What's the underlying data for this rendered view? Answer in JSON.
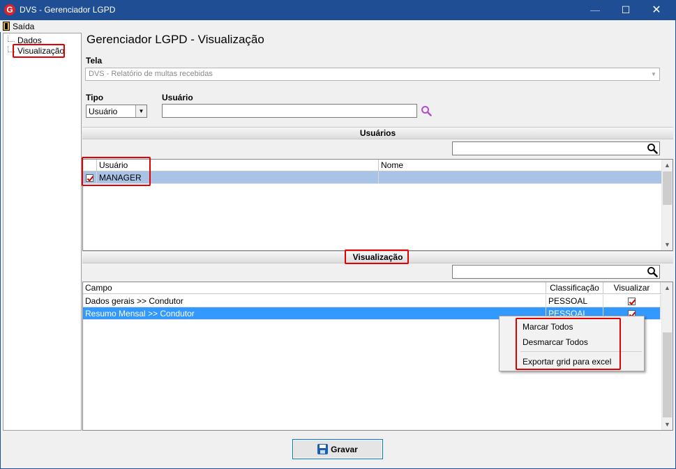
{
  "window": {
    "title": "DVS - Gerenciador LGPD",
    "app_icon_letter": "G",
    "minimize_glyph": "—",
    "maximize_glyph": "☐",
    "close_glyph": "✕"
  },
  "menu": {
    "exit_label": "Saída"
  },
  "sidebar": {
    "items": [
      {
        "label": "Dados"
      },
      {
        "label": "Visualização"
      }
    ]
  },
  "page_title": "Gerenciador LGPD - Visualização",
  "form": {
    "tela_label": "Tela",
    "tela_value": "DVS - Relatório de multas recebidas",
    "tipo_label": "Tipo",
    "tipo_value": "Usuário",
    "usuario_label": "Usuário",
    "usuario_value": ""
  },
  "usuarios_section": {
    "title": "Usuários",
    "columns": [
      "Usuário",
      "Nome"
    ],
    "rows": [
      {
        "usuario": "MANAGER",
        "nome": "",
        "checked": true
      }
    ]
  },
  "visualizacao_section": {
    "title": "Visualização",
    "columns": [
      "Campo",
      "Classificação",
      "Visualizar"
    ],
    "rows": [
      {
        "campo": "Dados gerais >> Condutor",
        "classificacao": "PESSOAL",
        "visualizar": true
      },
      {
        "campo": "Resumo Mensal >> Condutor",
        "classificacao": "PESSOAL",
        "visualizar": true
      }
    ]
  },
  "context_menu": {
    "items": [
      "Marcar Todos",
      "Desmarcar Todos",
      "Exportar grid para excel"
    ]
  },
  "save_button": {
    "label": "Gravar"
  },
  "colors": {
    "titlebar": "#1f4e95",
    "highlight_red": "#e20000",
    "selection_light": "#a9c3e6",
    "selection_blue": "#3399ff",
    "search_icon": "#b04fd0"
  },
  "icons": {
    "search": "magnifier-icon",
    "save": "floppy-disk-icon",
    "exit": "exit-door-icon"
  }
}
